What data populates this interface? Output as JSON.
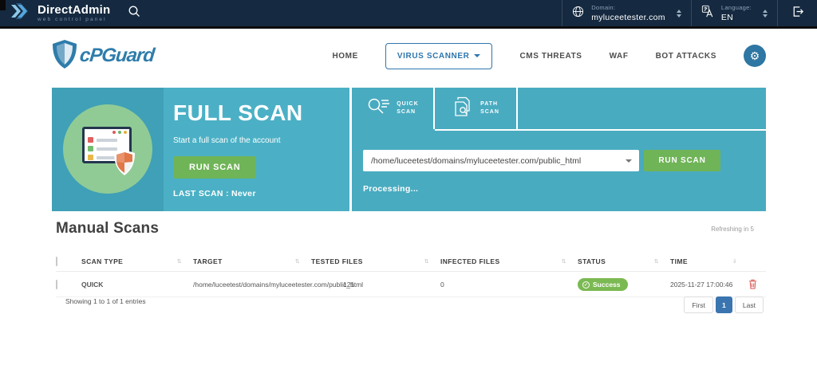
{
  "topbar": {
    "brand": {
      "name": "DirectAdmin",
      "tagline": "web control panel"
    },
    "domain": {
      "label": "Domain:",
      "value": "myluceetester.com"
    },
    "language": {
      "label": "Language:",
      "value": "EN"
    },
    "icons": [
      "directadmin-chevrons-icon",
      "search-icon",
      "globe-icon",
      "translate-icon",
      "logout-icon"
    ]
  },
  "nav": {
    "logo_text": "cPGuard",
    "items": [
      {
        "label": "HOME",
        "active": false
      },
      {
        "label": "VIRUS SCANNER",
        "active": true
      },
      {
        "label": "CMS THREATS",
        "active": false
      },
      {
        "label": "WAF",
        "active": false
      },
      {
        "label": "BOT ATTACKS",
        "active": false
      }
    ],
    "settings_icon": "gear-icon"
  },
  "full_scan": {
    "title": "FULL SCAN",
    "subtitle": "Start a full scan of the account",
    "run_label": "RUN SCAN",
    "last_scan": "LAST SCAN : Never"
  },
  "scanner": {
    "tabs": [
      {
        "line1": "QUICK",
        "line2": "SCAN",
        "icon": "magnifier-lines-icon",
        "active": true
      },
      {
        "line1": "PATH",
        "line2": "SCAN",
        "icon": "documents-magnifier-icon",
        "active": false
      }
    ],
    "path_value": "/home/luceetest/domains/myluceetester.com/public_html",
    "run_label": "RUN SCAN",
    "status_text": "Processing..."
  },
  "manual_scans": {
    "title": "Manual Scans",
    "refresh_note": "Refreshing in 5",
    "columns": [
      "SCAN TYPE",
      "TARGET",
      "TESTED FILES",
      "INFECTED FILES",
      "STATUS",
      "TIME"
    ],
    "rows": [
      {
        "scan_type": "QUICK",
        "target": "/home/luceetest/domains/myluceetester.com/public_html",
        "tested_files": "121",
        "infected_files": "0",
        "status": "Success",
        "time": "2025-11-27 17:00:46"
      }
    ],
    "summary": "Showing 1 to 1 of 1 entries",
    "pagination": {
      "first": "First",
      "page": "1",
      "last": "Last"
    }
  },
  "colors": {
    "topbar_bg": "#152a40",
    "teal_card": "#4bb0c5",
    "teal_dark": "#3fa0b7",
    "green_button": "#6fb457",
    "badge_green": "#7bb952",
    "brand_blue": "#2e7cab",
    "active_page_blue": "#3a75b0",
    "danger_red": "#d9534f"
  }
}
